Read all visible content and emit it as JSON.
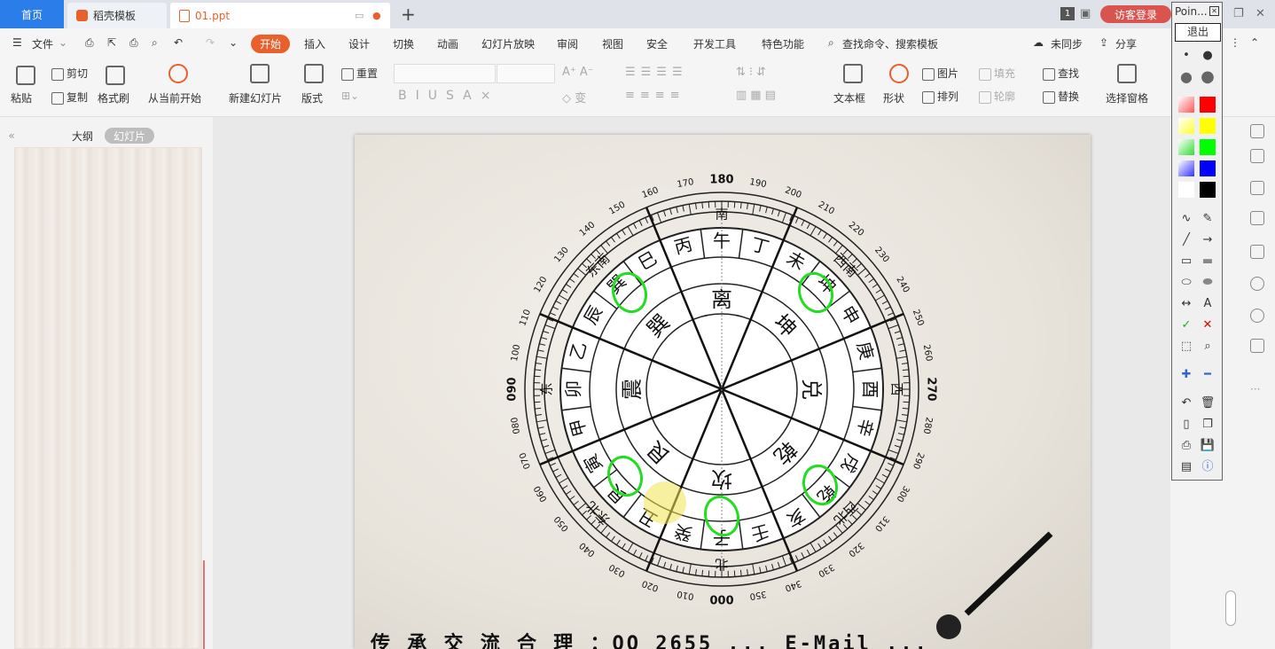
{
  "tabs": {
    "home": "首页",
    "daoke": "稻壳模板",
    "file": "01.ppt",
    "add": "+",
    "badge": "1",
    "login": "访客登录"
  },
  "menu": {
    "file": "文件",
    "active": "开始",
    "items": [
      "插入",
      "设计",
      "切换",
      "动画",
      "幻灯片放映",
      "审阅",
      "视图",
      "安全",
      "开发工具",
      "特色功能"
    ],
    "search": "查找命令、搜索模板",
    "sync": "未同步",
    "share": "分享"
  },
  "ribbon": {
    "paste": "粘贴",
    "cut": "剪切",
    "copy": "复制",
    "format_painter": "格式刷",
    "from_current": "从当前开始",
    "new_slide": "新建幻灯片",
    "layout": "版式",
    "reset": "重置",
    "textbox": "文本框",
    "shape": "形状",
    "picture": "图片",
    "fill": "填充",
    "arrange": "排列",
    "outline": "轮廓",
    "find": "查找",
    "replace": "替换",
    "select_pane": "选择窗格"
  },
  "leftpane": {
    "outline": "大纲",
    "slides": "幻灯片"
  },
  "palette": {
    "title": "Poin...",
    "exit": "退出"
  },
  "compass": {
    "outer_numbers": [
      "000",
      "010",
      "020",
      "030",
      "040",
      "050",
      "060",
      "070",
      "080",
      "090",
      "100",
      "110",
      "120",
      "130",
      "140",
      "150",
      "160",
      "170",
      "180",
      "190",
      "200",
      "210",
      "220",
      "230",
      "240",
      "250",
      "260",
      "270",
      "280",
      "290",
      "300",
      "310",
      "320",
      "330",
      "340",
      "350"
    ],
    "trigrams": [
      "离",
      "坤",
      "兑",
      "乾",
      "坎",
      "艮",
      "震",
      "巽"
    ],
    "mountains": [
      "午",
      "丁",
      "未",
      "坤",
      "申",
      "庚",
      "酉",
      "辛",
      "戌",
      "乾",
      "亥",
      "壬",
      "子",
      "癸",
      "丑",
      "艮",
      "寅",
      "甲",
      "卯",
      "乙",
      "辰",
      "巽",
      "巳",
      "丙"
    ],
    "directions": [
      "南",
      "西南",
      "西",
      "西北",
      "北",
      "东北",
      "东",
      "东南"
    ]
  },
  "slide": {
    "footer": "传 承 交 流 合 理 ：QQ 2655 ... E-Mail ..."
  },
  "colors": {
    "accent": "#e8612c",
    "home_tab": "#2b7de9",
    "login": "#d9534f",
    "annotation": "#22dd22"
  }
}
